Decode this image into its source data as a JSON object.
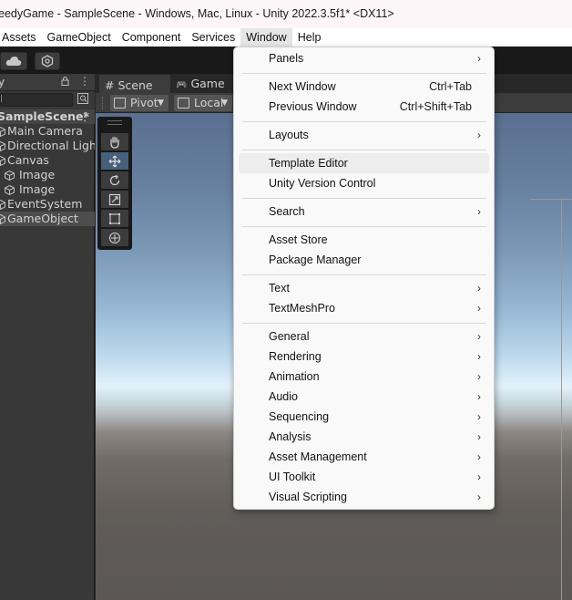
{
  "window": {
    "title": "eedyGame - SampleScene - Windows, Mac, Linux - Unity 2022.3.5f1* <DX11>"
  },
  "menubar": {
    "items": [
      "Assets",
      "GameObject",
      "Component",
      "Services",
      "Window",
      "Help"
    ]
  },
  "hierarchy": {
    "tab_label": "y",
    "search_placeholder": "l",
    "scene_name": "SampleScene*",
    "items": [
      "Main Camera",
      "Directional Light",
      "Canvas",
      "Image",
      "Image",
      "EventSystem",
      "GameObject"
    ]
  },
  "scene_view": {
    "tabs": [
      {
        "icon": "#",
        "label": "Scene"
      },
      {
        "icon": "🎮",
        "label": "Game"
      }
    ],
    "pivot_label": "Pivot",
    "local_label": "Local"
  },
  "window_menu": {
    "items": [
      {
        "label": "Panels",
        "submenu": true
      },
      {
        "label": "Next Window",
        "shortcut": "Ctrl+Tab"
      },
      {
        "label": "Previous Window",
        "shortcut": "Ctrl+Shift+Tab"
      },
      {
        "label": "Layouts",
        "submenu": true
      },
      {
        "label": "Template Editor"
      },
      {
        "label": "Unity Version Control"
      },
      {
        "label": "Search",
        "submenu": true
      },
      {
        "label": "Asset Store"
      },
      {
        "label": "Package Manager"
      },
      {
        "label": "Text",
        "submenu": true
      },
      {
        "label": "TextMeshPro",
        "submenu": true
      },
      {
        "label": "General",
        "submenu": true
      },
      {
        "label": "Rendering",
        "submenu": true
      },
      {
        "label": "Animation",
        "submenu": true
      },
      {
        "label": "Audio",
        "submenu": true
      },
      {
        "label": "Sequencing",
        "submenu": true
      },
      {
        "label": "Analysis",
        "submenu": true
      },
      {
        "label": "Asset Management",
        "submenu": true
      },
      {
        "label": "UI Toolkit",
        "submenu": true
      },
      {
        "label": "Visual Scripting",
        "submenu": true
      }
    ],
    "arrow_glyph": "›"
  },
  "colors": {
    "selected_tool": "#46607c",
    "menu_background": "#f9f9f9"
  }
}
